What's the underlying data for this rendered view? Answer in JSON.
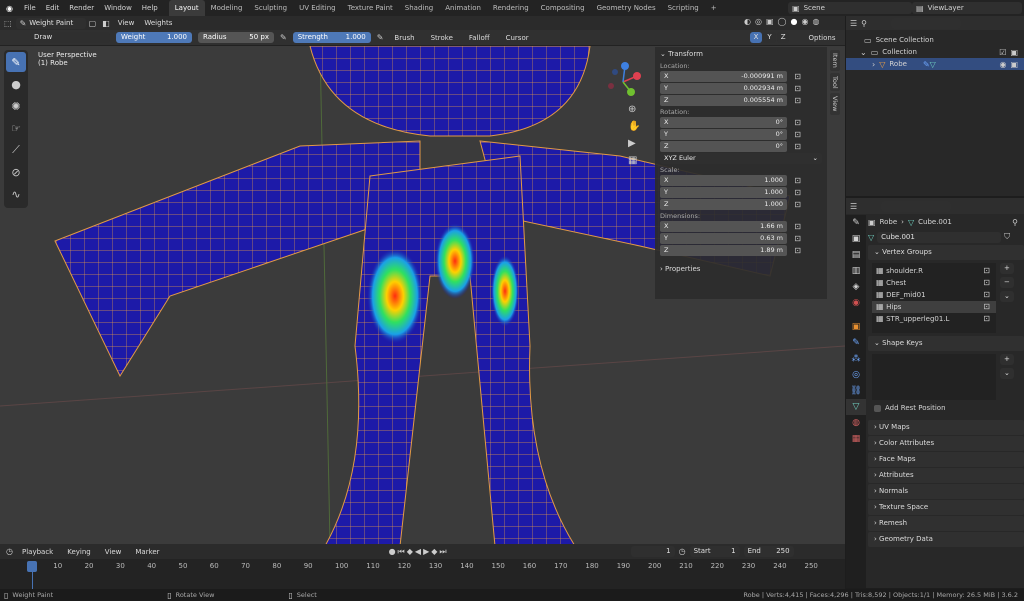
{
  "topbar": {
    "menu": [
      "File",
      "Edit",
      "Render",
      "Window",
      "Help"
    ],
    "workspaces": [
      "Layout",
      "Modeling",
      "Sculpting",
      "UV Editing",
      "Texture Paint",
      "Shading",
      "Animation",
      "Rendering",
      "Compositing",
      "Geometry Nodes",
      "Scripting"
    ],
    "add_tab": "+",
    "scene": "Scene",
    "view_layer": "ViewLayer"
  },
  "header": {
    "mode": "Weight Paint",
    "view": "View",
    "weights": "Weights"
  },
  "tool_settings": {
    "brush": "Draw",
    "weight_label": "Weight",
    "weight_value": "1.000",
    "radius_label": "Radius",
    "radius_value": "50 px",
    "strength_label": "Strength",
    "strength_value": "1.000",
    "brush_menu": "Brush",
    "stroke_menu": "Stroke",
    "falloff_menu": "Falloff",
    "cursor_menu": "Cursor",
    "xyz": [
      "X",
      "Y",
      "Z"
    ],
    "options": "Options"
  },
  "viewport": {
    "perspective": "User Perspective",
    "object": "(1) Robe"
  },
  "npanel": {
    "title": "Transform",
    "location_label": "Location:",
    "location": [
      {
        "axis": "X",
        "value": "-0.000991 m"
      },
      {
        "axis": "Y",
        "value": "0.002934 m"
      },
      {
        "axis": "Z",
        "value": "0.005554 m"
      }
    ],
    "rotation_label": "Rotation:",
    "rotation": [
      {
        "axis": "X",
        "value": "0°"
      },
      {
        "axis": "Y",
        "value": "0°"
      },
      {
        "axis": "Z",
        "value": "0°"
      }
    ],
    "rotation_mode": "XYZ Euler",
    "scale_label": "Scale:",
    "scale": [
      {
        "axis": "X",
        "value": "1.000"
      },
      {
        "axis": "Y",
        "value": "1.000"
      },
      {
        "axis": "Z",
        "value": "1.000"
      }
    ],
    "dimensions_label": "Dimensions:",
    "dimensions": [
      {
        "axis": "X",
        "value": "1.66 m"
      },
      {
        "axis": "Y",
        "value": "0.63 m"
      },
      {
        "axis": "Z",
        "value": "1.89 m"
      }
    ],
    "properties": "Properties",
    "side_tabs": [
      "Item",
      "Tool",
      "View"
    ]
  },
  "outliner": {
    "scene_collection": "Scene Collection",
    "collection": "Collection",
    "object": "Robe"
  },
  "properties": {
    "breadcrumb_object": "Robe",
    "breadcrumb_mesh": "Cube.001",
    "mesh_name": "Cube.001",
    "vertex_groups_title": "Vertex Groups",
    "vertex_groups": [
      "shoulder.R",
      "Chest",
      "DEF_mid01",
      "Hips",
      "STR_upperleg01.L"
    ],
    "selected_group": "Hips",
    "shape_keys_title": "Shape Keys",
    "add_rest_position": "Add Rest Position",
    "panels": [
      "UV Maps",
      "Color Attributes",
      "Face Maps",
      "Attributes",
      "Normals",
      "Texture Space",
      "Remesh",
      "Geometry Data"
    ]
  },
  "timeline": {
    "playback": "Playback",
    "keying": "Keying",
    "view": "View",
    "marker": "Marker",
    "current_frame": "1",
    "start_label": "Start",
    "start": "1",
    "end_label": "End",
    "end": "250",
    "ticks": [
      "1",
      "10",
      "20",
      "30",
      "40",
      "50",
      "60",
      "70",
      "80",
      "90",
      "100",
      "110",
      "120",
      "130",
      "140",
      "150",
      "160",
      "170",
      "180",
      "190",
      "200",
      "210",
      "220",
      "230",
      "240",
      "250"
    ]
  },
  "status": {
    "left": "Weight Paint",
    "middle": "Rotate View",
    "select": "Select",
    "stats": "Robe | Verts:4,415 | Faces:4,296 | Tris:8,592 | Objects:1/1 | Memory: 26.5 MiB | 3.6.2"
  },
  "colors": {
    "accent": "#4772b3",
    "mesh": "#1a1ab0",
    "wire": "#e8a040"
  }
}
